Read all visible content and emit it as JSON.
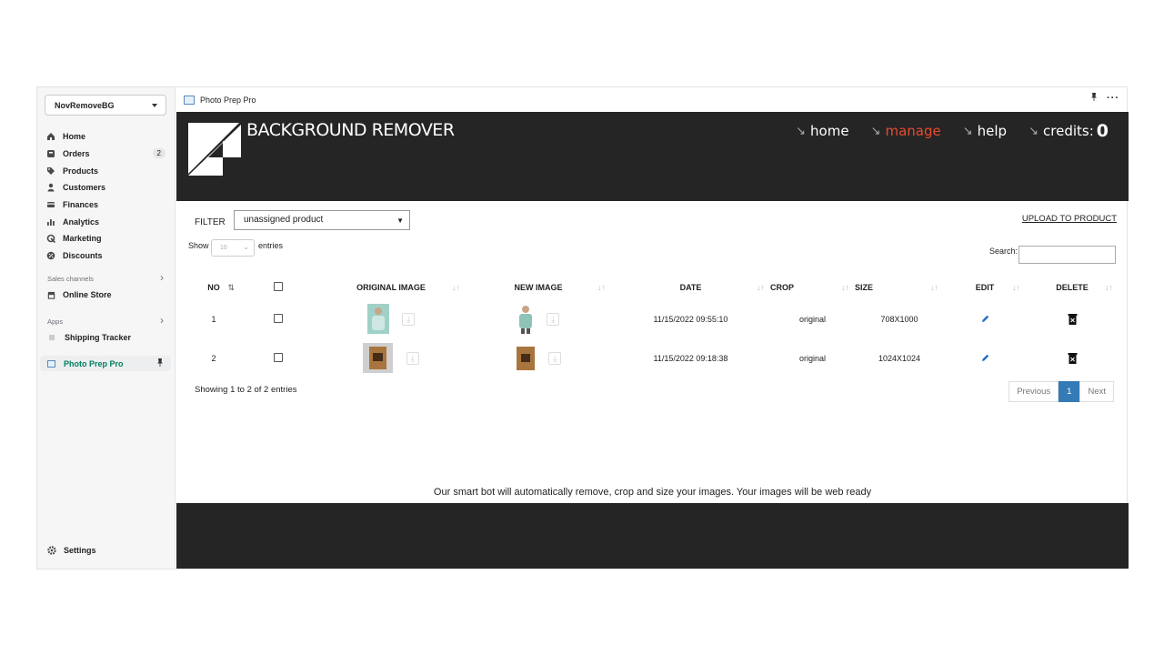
{
  "store": {
    "name": "NovRemoveBG"
  },
  "sidebar": {
    "items": [
      {
        "label": "Home",
        "icon": "home-icon"
      },
      {
        "label": "Orders",
        "icon": "orders-icon",
        "badge": "2"
      },
      {
        "label": "Products",
        "icon": "tag-icon"
      },
      {
        "label": "Customers",
        "icon": "person-icon"
      },
      {
        "label": "Finances",
        "icon": "finances-icon"
      },
      {
        "label": "Analytics",
        "icon": "bar-chart-icon"
      },
      {
        "label": "Marketing",
        "icon": "marketing-icon"
      },
      {
        "label": "Discounts",
        "icon": "discount-icon"
      }
    ],
    "sales_channels_label": "Sales channels",
    "online_store": "Online Store",
    "apps_label": "Apps",
    "shipping_tracker": "Shipping Tracker",
    "active_app": "Photo Prep Pro",
    "settings": "Settings"
  },
  "app_bar": {
    "title": "Photo Prep Pro"
  },
  "hero": {
    "brand": "BACKGROUND REMOVER",
    "nav": {
      "home": "home",
      "manage": "manage",
      "help": "help",
      "credits_label": "credits:",
      "credits_value": "0"
    },
    "active_color": "#e74c2e"
  },
  "filter": {
    "label": "FILTER",
    "value": "unassigned product"
  },
  "upload_link": "UPLOAD TO PRODUCT",
  "show": {
    "label": "Show",
    "value": "10",
    "suffix": "entries"
  },
  "search": {
    "label": "Search:"
  },
  "table": {
    "headers": {
      "no": "NO",
      "original": "ORIGINAL IMAGE",
      "new": "NEW IMAGE",
      "date": "DATE",
      "crop": "CROP",
      "size": "SIZE",
      "edit": "EDIT",
      "delete": "DELETE"
    },
    "rows": [
      {
        "no": "1",
        "date": "11/15/2022 09:55:10",
        "crop": "original",
        "size": "708X1000"
      },
      {
        "no": "2",
        "date": "11/15/2022 09:18:38",
        "crop": "original",
        "size": "1024X1024"
      }
    ]
  },
  "info": "Showing 1 to 2 of 2 entries",
  "pager": {
    "prev": "Previous",
    "current": "1",
    "next": "Next"
  },
  "tagline": "Our smart bot will automatically remove, crop and size your images. Your images will be web ready"
}
